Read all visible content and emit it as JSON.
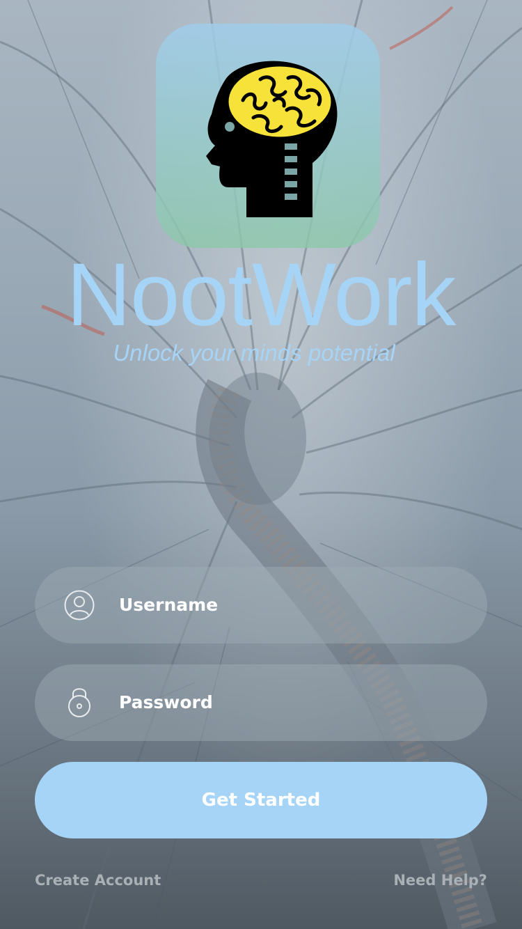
{
  "app": {
    "title": "NootWork",
    "tagline": "Unlock your minds potential"
  },
  "form": {
    "username_placeholder": "Username",
    "password_placeholder": "Password",
    "submit_label": "Get Started"
  },
  "footer": {
    "create_account": "Create Account",
    "need_help": "Need Help?"
  },
  "icons": {
    "logo": "brain-head-icon",
    "username": "user-icon",
    "password": "lock-icon"
  },
  "colors": {
    "accent": "#a6d4f7",
    "brain_yellow": "#f7e23a",
    "field_text": "#ffffff",
    "footer_text": "#a9b0b6"
  }
}
